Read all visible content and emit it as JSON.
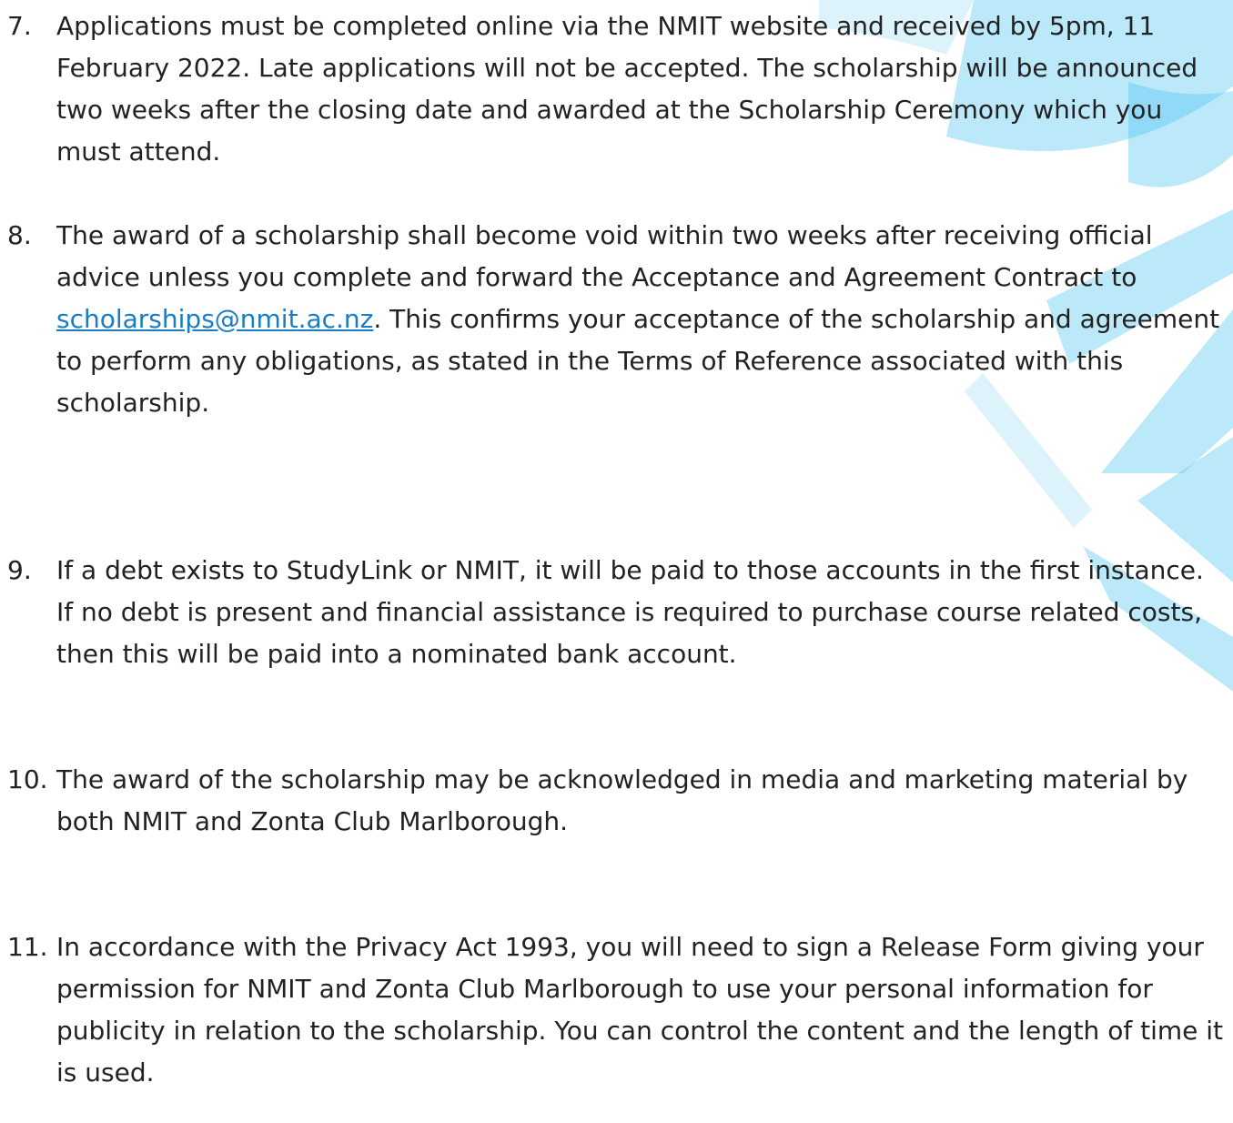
{
  "colors": {
    "text": "#222222",
    "link": "#1a7dc4",
    "watermark": "#3fbff0"
  },
  "items": [
    {
      "number": "7.",
      "text": "Applications must be completed online via the NMIT website and received by 5pm, 11 February 2022.  Late applications will not be accepted.  The scholarship will be announced two weeks after the closing date and awarded at the Scholarship Ceremony which you must attend."
    },
    {
      "number": "8.",
      "text_before": "The award of a scholarship shall become void within two weeks after receiving official advice unless you complete and forward the Acceptance and Agreement Contract to ",
      "email": "scholarships@nmit.ac.nz",
      "text_after": ".  This confirms your acceptance of the scholarship and agreement to perform any obligations, as stated in the Terms of Reference associated with this scholarship."
    },
    {
      "number": "9.",
      "text": "If a debt exists to StudyLink or NMIT, it will be paid to those accounts in the first instance.  If no debt is present and financial assistance is required to purchase course related costs, then this will be paid into a nominated bank account."
    },
    {
      "number": "10.",
      "text": "The award of the scholarship may be acknowledged in media and marketing material by both NMIT and Zonta Club Marlborough."
    },
    {
      "number": "11.",
      "text": "In accordance with the Privacy Act 1993, you will need to sign a Release Form giving your permission for NMIT and Zonta Club Marlborough to use your personal information for publicity in relation to the scholarship.  You can control the content and the length of time it is used."
    }
  ]
}
